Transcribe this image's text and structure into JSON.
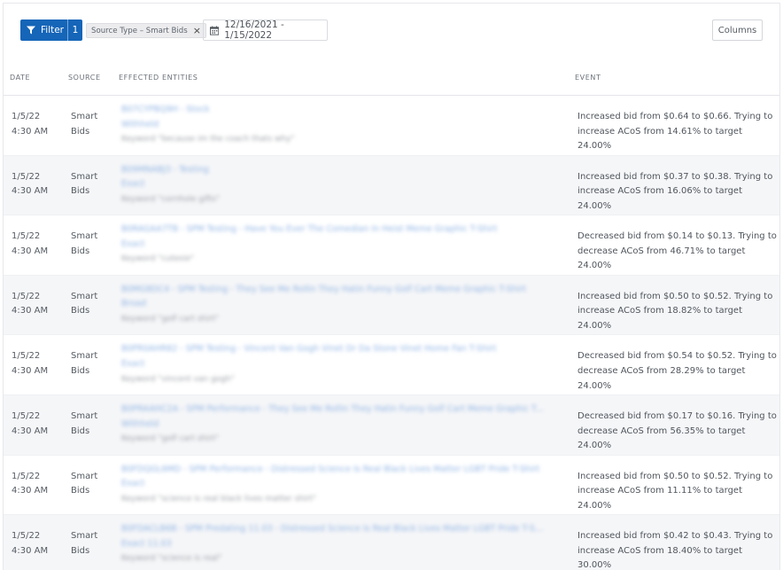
{
  "toolbar": {
    "filter_label": "Filter",
    "filter_count": "1",
    "chip_label": "Source Type – Smart Bids",
    "chip_close": "×",
    "date_range": "12/16/2021 - 1/15/2022",
    "columns_label": "Columns"
  },
  "table": {
    "headers": {
      "date": "DATE",
      "source": "SOURCE",
      "entities": "EFFECTED ENTITIES",
      "event": "EVENT"
    },
    "rows": [
      {
        "date": "1/5/22",
        "time": "4:30 AM",
        "source_1": "Smart",
        "source_2": "Bids",
        "entity_line1": "B07CYPBQ9H - Stock",
        "entity_line2": "Withheld",
        "keyword": "Keyword \"because im the coach thats why\"",
        "event": "Increased bid from $0.64 to $0.66. Trying to increase ACoS from 14.61% to target 24.00%"
      },
      {
        "date": "1/5/22",
        "time": "4:30 AM",
        "source_1": "Smart",
        "source_2": "Bids",
        "entity_line1": "B09MNABJ3 - Testing",
        "entity_line2": "Exact",
        "keyword": "Keyword \"cornhole gifts\"",
        "event": "Increased bid from $0.37 to $0.38. Trying to increase ACoS from 16.06% to target 24.00%"
      },
      {
        "date": "1/5/22",
        "time": "4:30 AM",
        "source_1": "Smart",
        "source_2": "Bids",
        "entity_line1": "B0RAGAA7TB - SPM Testing - Have You Ever The Comedian In Heist Meme Graphic T-Shirt",
        "entity_line2": "Exact",
        "keyword": "Keyword \"cutesie\"",
        "event": "Decreased bid from $0.14 to $0.13. Trying to decrease ACoS from 46.71% to target 24.00%"
      },
      {
        "date": "1/5/22",
        "time": "4:30 AM",
        "source_1": "Smart",
        "source_2": "Bids",
        "entity_line1": "B0MG8DC4 - SPM Testing - They See Me Rollin They Hatin Funny Golf Cart Meme Graphic T-Shirt",
        "entity_line2": "Broad",
        "keyword": "Keyword \"golf cart shirt\"",
        "event": "Increased bid from $0.50 to $0.52. Trying to increase ACoS from 18.82% to target 24.00%"
      },
      {
        "date": "1/5/22",
        "time": "4:30 AM",
        "source_1": "Smart",
        "source_2": "Bids",
        "entity_line1": "B0PR0AHR82 - SPM Testing - Vincent Van Gogh Vinet Dr Da Stone Vinet Home Fan T-Shirt",
        "entity_line2": "Exact",
        "keyword": "Keyword \"vincent van gogh\"",
        "event": "Decreased bid from $0.54 to $0.52. Trying to decrease ACoS from 28.29% to target 24.00%"
      },
      {
        "date": "1/5/22",
        "time": "4:30 AM",
        "source_1": "Smart",
        "source_2": "Bids",
        "entity_line1": "B0PRAAHC2A - SPM Performance - They See Me Rollin They Hatin Funny Golf Cart Meme Graphic T-Shirt",
        "entity_line2": "Withheld",
        "keyword": "Keyword \"golf cart shirt\"",
        "event": "Decreased bid from $0.17 to $0.16. Trying to decrease ACoS from 56.35% to target 24.00%"
      },
      {
        "date": "1/5/22",
        "time": "4:30 AM",
        "source_1": "Smart",
        "source_2": "Bids",
        "entity_line1": "B0FDQGL6MD - SPM Performance - Distressed Science Is Real Black Lives Matter LGBT Pride T-Shirt",
        "entity_line2": "Exact",
        "keyword": "Keyword \"science is real black lives matter shirt\"",
        "event": "Increased bid from $0.50 to $0.52. Trying to increase ACoS from 11.11% to target 24.00%"
      },
      {
        "date": "1/5/22",
        "time": "4:30 AM",
        "source_1": "Smart",
        "source_2": "Bids",
        "entity_line1": "B0FDACLB6B - SPM Predating 11.03 - Distressed Science Is Real Black Lives Matter LGBT Pride T-Shirt",
        "entity_line2": "Exact 11.03",
        "keyword": "Keyword \"science is real\"",
        "event": "Increased bid from $0.42 to $0.43. Trying to increase ACoS from 18.40% to target 30.00%"
      }
    ]
  },
  "colors": {
    "primary": "#1565b8",
    "link": "#8fb3e4",
    "row_alt": "#f5f6f8"
  },
  "icons": {
    "filter": "funnel-icon",
    "date": "calendar-icon",
    "chip_close": "close-icon"
  }
}
